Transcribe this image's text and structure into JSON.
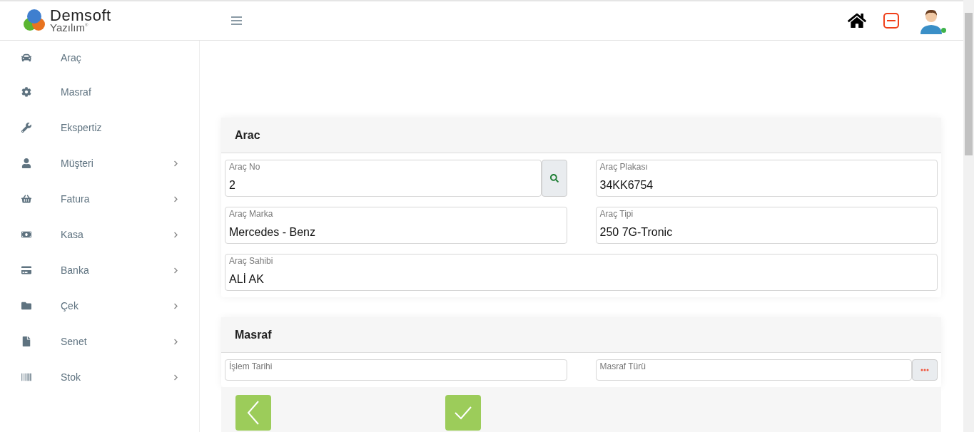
{
  "logo": {
    "name": "Demsoft",
    "subtitle": "Yazılım",
    "mark": "®"
  },
  "user": {
    "online": true
  },
  "sidebar": {
    "items": [
      {
        "label": "Araç",
        "has_submenu": false
      },
      {
        "label": "Masraf",
        "has_submenu": false
      },
      {
        "label": "Ekspertiz",
        "has_submenu": false
      },
      {
        "label": "Müşteri",
        "has_submenu": true
      },
      {
        "label": "Fatura",
        "has_submenu": true
      },
      {
        "label": "Kasa",
        "has_submenu": true
      },
      {
        "label": "Banka",
        "has_submenu": true
      },
      {
        "label": "Çek",
        "has_submenu": true
      },
      {
        "label": "Senet",
        "has_submenu": true
      },
      {
        "label": "Stok",
        "has_submenu": true
      }
    ]
  },
  "sections": [
    {
      "title": "Arac",
      "fields": [
        {
          "label": "Araç No",
          "value": "2",
          "kind": "search",
          "wide": false
        },
        {
          "label": "Araç Plakası",
          "value": "34KK6754",
          "kind": "plain",
          "wide": false
        },
        {
          "label": "Araç Marka",
          "value": "Mercedes - Benz",
          "kind": "plain",
          "wide": false
        },
        {
          "label": "Araç Tipi",
          "value": "250 7G-Tronic",
          "kind": "plain",
          "wide": false
        },
        {
          "label": "Araç Sahibi",
          "value": "ALİ AK",
          "kind": "plain",
          "wide": true
        }
      ]
    },
    {
      "title": "Masraf",
      "fields": [
        {
          "label": "İşlem Tarihi",
          "kind": "plain",
          "wide": false
        },
        {
          "label": "Masraf Türü",
          "kind": "more",
          "wide": false
        }
      ]
    }
  ]
}
